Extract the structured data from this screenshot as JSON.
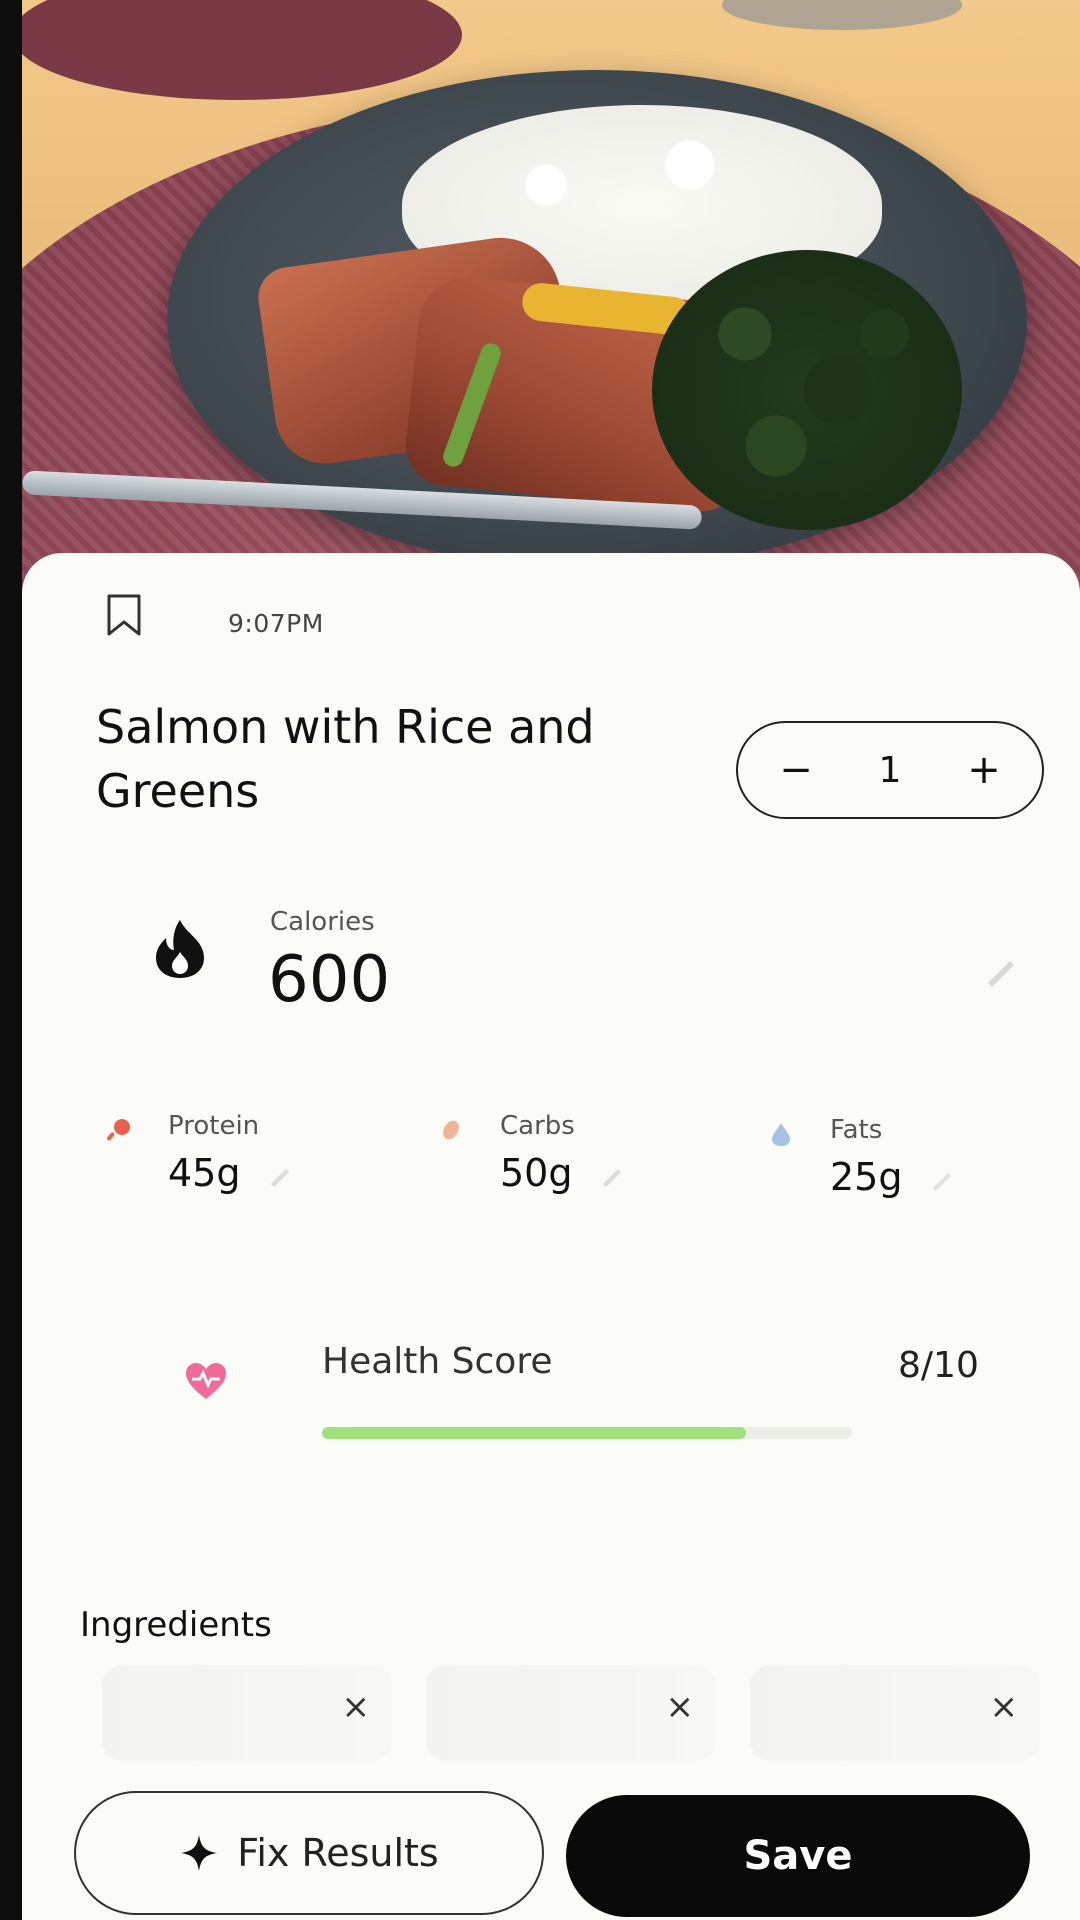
{
  "meal": {
    "time": "9:07PM",
    "title": "Salmon with Rice and Greens",
    "servings": "1"
  },
  "stepper": {
    "minus_symbol": "−",
    "plus_symbol": "+"
  },
  "calories": {
    "label": "Calories",
    "value": "600"
  },
  "macros": [
    {
      "label": "Protein",
      "value": "45g",
      "icon": "drumstick-icon",
      "color": "#e8614f"
    },
    {
      "label": "Carbs",
      "value": "50g",
      "icon": "wheat-icon",
      "color": "#e9a07a"
    },
    {
      "label": "Fats",
      "value": "25g",
      "icon": "droplet-icon",
      "color": "#8fb6e0"
    }
  ],
  "health_score": {
    "label": "Health Score",
    "value": "8/10",
    "level": 0.8,
    "color": "#9fe07f"
  },
  "ingredients": {
    "title": "Ingredients",
    "remove_symbol": "×"
  },
  "actions": {
    "fix_label": "Fix Results",
    "save_label": "Save"
  },
  "colors": {
    "accent": "#0a0a0a",
    "background": "#fbfbf7"
  }
}
